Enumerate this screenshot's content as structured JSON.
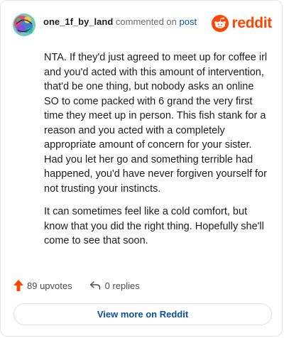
{
  "comment": {
    "author": "one_1f_by_land",
    "action_text": "commented on",
    "post_link": "post",
    "paragraphs": [
      "NTA. If they'd just agreed to meet up for coffee irl and you'd acted with this amount of intervention, that'd be one thing, but nobody asks an online SO to come packed with 6 grand the very first time they meet up in person. This fish stank for a reason and you acted with a completely appropriate amount of concern for your sister. Had you let her go and something terrible had happened, you'd have never forgiven yourself for not trusting your instincts.",
      "It can sometimes feel like a cold comfort, but know that you did the right thing. Hopefully she'll come to see that soon."
    ]
  },
  "brand": {
    "wordmark": "reddit",
    "color": "#ff4500"
  },
  "stats": {
    "upvotes": "89 upvotes",
    "replies": "0 replies"
  },
  "cta": {
    "label": "View more on Reddit"
  },
  "colors": {
    "link": "#0b4ea2",
    "muted": "#6b6b6b",
    "upvote": "#ff4500"
  },
  "icons": [
    "avatar",
    "reddit-logo-icon",
    "upvote-arrow-icon",
    "reply-arrow-icon"
  ]
}
